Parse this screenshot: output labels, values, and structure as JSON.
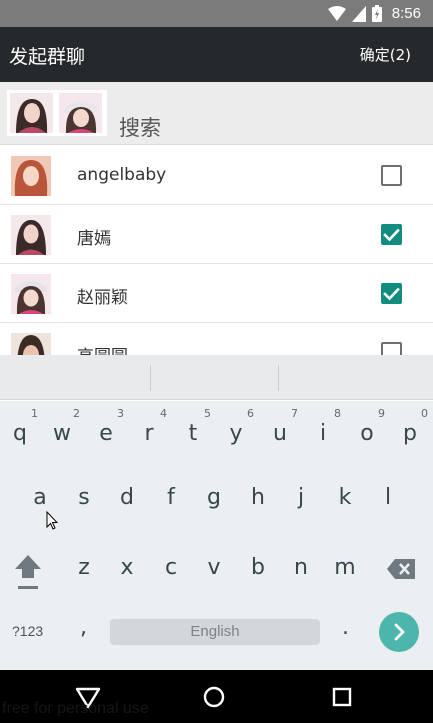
{
  "status_bar": {
    "time": "8:56",
    "icons": [
      "wifi-icon",
      "signal-icon",
      "battery-icon"
    ]
  },
  "toolbar": {
    "title": "发起群聊",
    "confirm_label": "确定(2)"
  },
  "search": {
    "label": "搜索"
  },
  "contacts": [
    {
      "name": "angelbaby",
      "checked": false
    },
    {
      "name": "唐嫣",
      "checked": true
    },
    {
      "name": "赵丽颖",
      "checked": true
    },
    {
      "name": "高圆圆",
      "checked": false
    }
  ],
  "keyboard": {
    "row1": [
      {
        "key": "q",
        "hint": "1"
      },
      {
        "key": "w",
        "hint": "2"
      },
      {
        "key": "e",
        "hint": "3"
      },
      {
        "key": "r",
        "hint": "4"
      },
      {
        "key": "t",
        "hint": "5"
      },
      {
        "key": "y",
        "hint": "6"
      },
      {
        "key": "u",
        "hint": "7"
      },
      {
        "key": "i",
        "hint": "8"
      },
      {
        "key": "o",
        "hint": "9"
      },
      {
        "key": "p",
        "hint": "0"
      }
    ],
    "row2": [
      "a",
      "s",
      "d",
      "f",
      "g",
      "h",
      "j",
      "k",
      "l"
    ],
    "row3": [
      "z",
      "x",
      "c",
      "v",
      "b",
      "n",
      "m"
    ],
    "symbols_label": "?123",
    "comma": ",",
    "space_label": "English",
    "period": ".",
    "accent_color": "#4db6ac"
  },
  "watermark": "free for personal use",
  "colors": {
    "toolbar": "#25292c",
    "check_on": "#128c7e"
  }
}
